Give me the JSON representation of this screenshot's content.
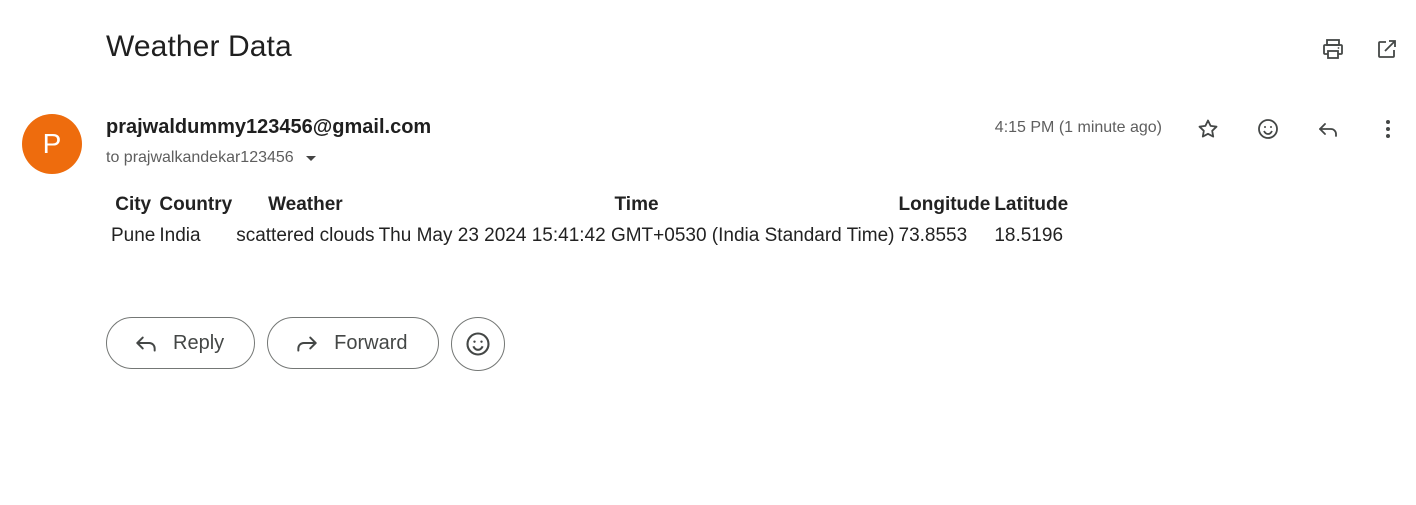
{
  "email": {
    "subject": "Weather Data",
    "avatar_letter": "P",
    "sender": "prajwaldummy123456@gmail.com",
    "recipient": "to prajwalkandekar123456",
    "timestamp": "4:15 PM (1 minute ago)"
  },
  "table": {
    "headers": [
      "City",
      "Country",
      "Weather",
      "Time",
      "Longitude",
      "Latitude"
    ],
    "rows": [
      [
        "Pune",
        "India",
        "scattered clouds",
        "Thu May 23 2024 15:41:42 GMT+0530 (India Standard Time)",
        "73.8553",
        "18.5196"
      ]
    ]
  },
  "actions": {
    "reply_label": "Reply",
    "forward_label": "Forward"
  },
  "icons": {
    "top": [
      "print-icon",
      "open-in-new-window-icon"
    ],
    "message": [
      "star-icon",
      "emoji-icon",
      "reply-icon",
      "more-vert-icon"
    ]
  },
  "colors": {
    "avatar": "#ee6c0d"
  }
}
